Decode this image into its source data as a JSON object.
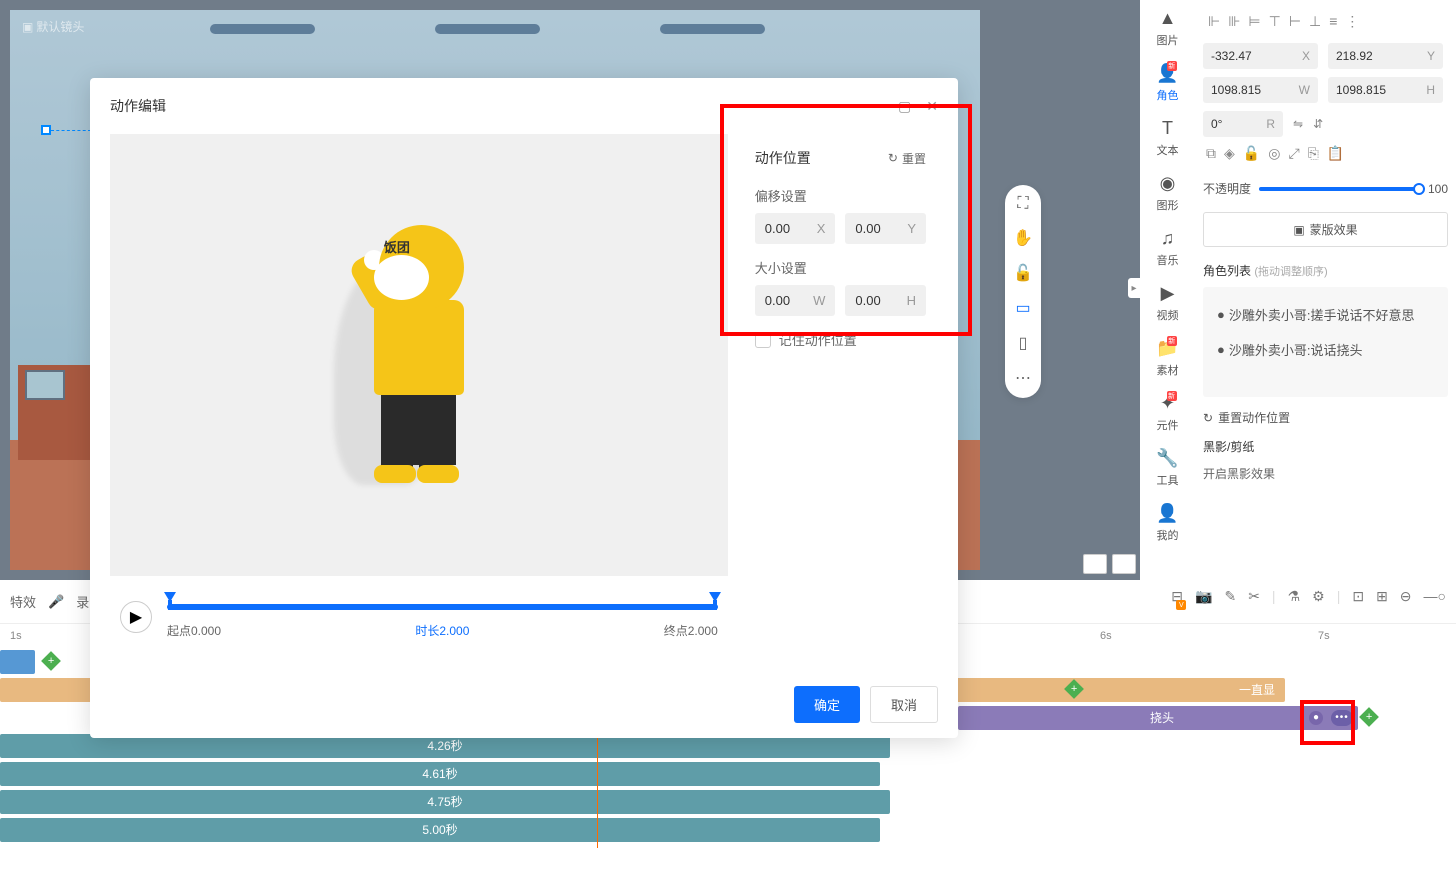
{
  "camera_label": "默认镜头",
  "char_hat_text": "饭团",
  "tool_sidebar": {
    "image": "图片",
    "character": "角色",
    "text": "文本",
    "shape": "图形",
    "music": "音乐",
    "video": "视频",
    "material": "素材",
    "component": "元件",
    "tools": "工具",
    "mine": "我的"
  },
  "properties": {
    "x": "-332.47",
    "y": "218.92",
    "w": "1098.815",
    "h": "1098.815",
    "rotation": "0°",
    "opacity_label": "不透明度",
    "opacity_value": "100",
    "mask_effect": "蒙版效果",
    "role_list_title": "角色列表",
    "role_list_hint": "(拖动调整顺序)",
    "role1": "沙雕外卖小哥:搓手说话不好意思",
    "role2": "沙雕外卖小哥:说话挠头",
    "reset_position": "重置动作位置",
    "shadow_section": "黑影/剪纸",
    "enable_shadow": "开启黑影效果"
  },
  "modal": {
    "title": "动作编辑",
    "action_position": "动作位置",
    "reset": "重置",
    "offset_label": "偏移设置",
    "offset_x": "0.00",
    "offset_y": "0.00",
    "size_label": "大小设置",
    "size_w": "0.00",
    "size_h": "0.00",
    "remember_position": "记住动作位置",
    "start_label": "起点0.000",
    "duration_label": "时长2.000",
    "end_label": "终点2.000",
    "confirm": "确定",
    "cancel": "取消"
  },
  "timeline": {
    "effect": "特效",
    "record": "录音",
    "time_1s": "1s",
    "time_6s": "6s",
    "time_7s": "7s",
    "purple_track_text": "挠头",
    "orange_track_text": "一直显",
    "track1": "4.26秒",
    "track2": "4.61秒",
    "track3": "4.75秒",
    "track4": "5.00秒"
  }
}
